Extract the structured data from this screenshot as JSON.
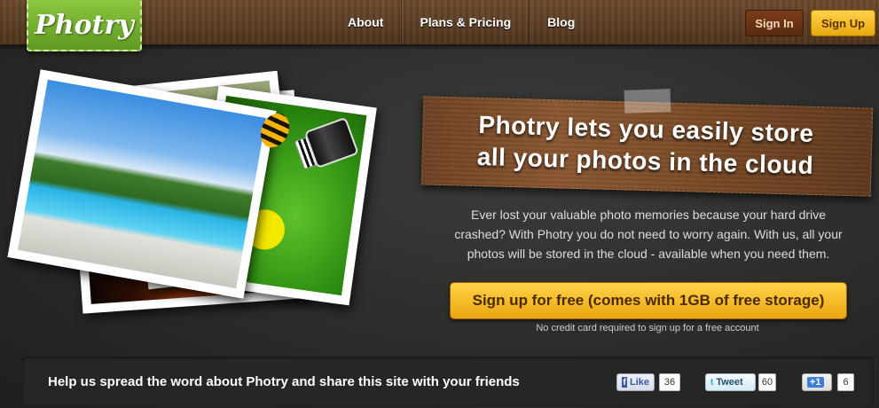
{
  "header": {
    "logo_text": "Photry",
    "nav": [
      "About",
      "Plans & Pricing",
      "Blog"
    ],
    "signin_label": "Sign In",
    "signup_label": "Sign Up"
  },
  "hero": {
    "tagline_line1": "Photry lets you easily store",
    "tagline_line2": "all your photos in the cloud",
    "description": "Ever lost your valuable photo memories because your hard drive crashed? With Photry you do not need to worry again. With us, all your photos will be stored in the cloud - available when you need them.",
    "cta_label": "Sign up for free (comes with 1GB of free storage)",
    "cta_note": "No credit card required to sign up for a free account"
  },
  "share": {
    "text": "Help us spread the word about Photry and share this site with your friends",
    "facebook": {
      "icon": "f",
      "label": "Like",
      "count": "36"
    },
    "twitter": {
      "icon": "t",
      "label": "Tweet",
      "count": "60"
    },
    "google": {
      "label": "+1",
      "count": "6"
    }
  },
  "colors": {
    "accent_yellow": "#ffd44a",
    "logo_green": "#8dc63f",
    "wood_brown": "#7a4a26"
  }
}
